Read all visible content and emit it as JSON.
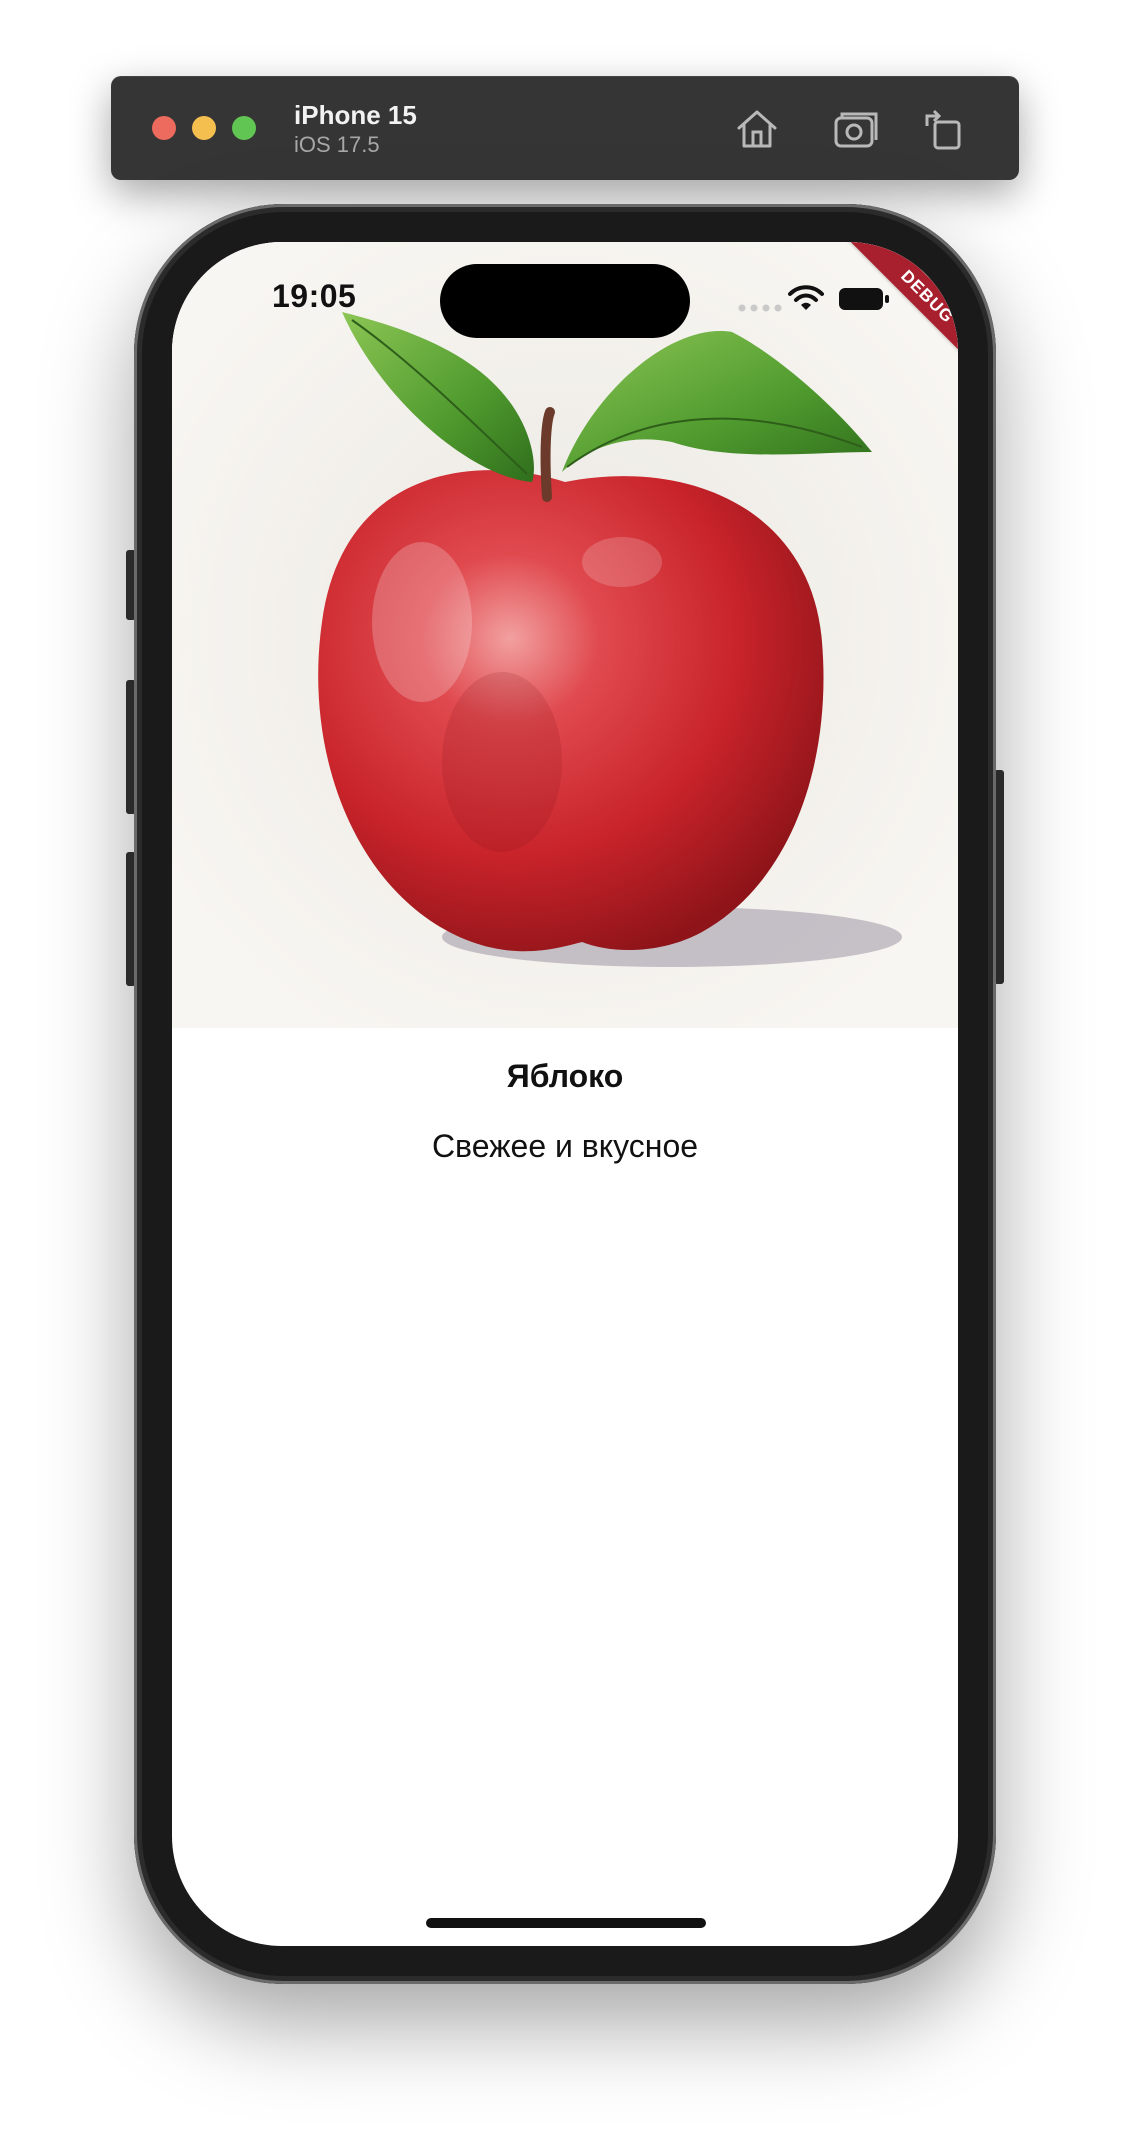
{
  "window": {
    "device_name": "iPhone 15",
    "os_version": "iOS 17.5",
    "toolbar_buttons": [
      "home-icon",
      "screenshot-icon",
      "rotate-icon"
    ]
  },
  "status_bar": {
    "time": "19:05"
  },
  "debug_banner": "DEBUG",
  "product": {
    "image": "apple-illustration",
    "title": "Яблоко",
    "description": "Свежее и вкусное"
  },
  "colors": {
    "debug_banner": "#a81f2e",
    "apple_red": "#d0252c",
    "leaf_green": "#4f9a2e",
    "traffic_red": "#ed6a5e",
    "traffic_yellow": "#f5bf4f",
    "traffic_green": "#61c554"
  }
}
